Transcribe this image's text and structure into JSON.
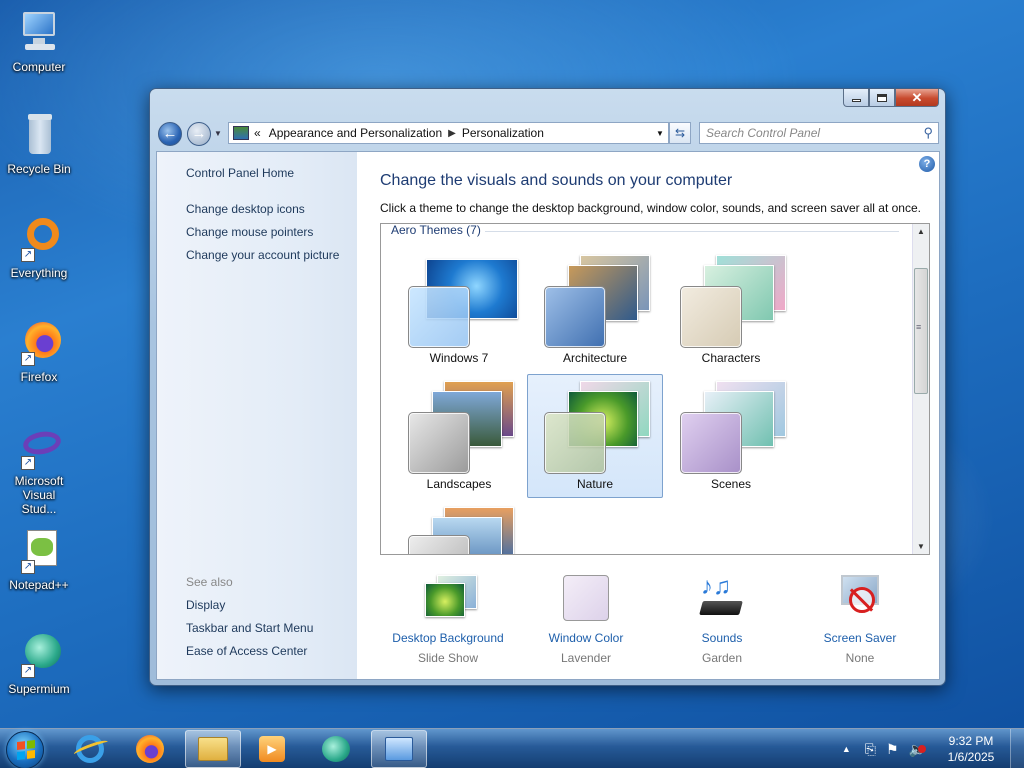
{
  "desktop": {
    "icons": [
      {
        "label": "Computer",
        "icon": "computer-icon"
      },
      {
        "label": "Recycle Bin",
        "icon": "recycle-bin-icon"
      },
      {
        "label": "Everything",
        "icon": "everything-app-icon"
      },
      {
        "label": "Firefox",
        "icon": "firefox-icon"
      },
      {
        "label": "Microsoft Visual Stud...",
        "icon": "visual-studio-icon"
      },
      {
        "label": "Notepad++",
        "icon": "notepad-plus-plus-icon"
      },
      {
        "label": "Supermium",
        "icon": "supermium-icon"
      }
    ]
  },
  "window": {
    "address": {
      "overflow": "«",
      "crumbs": [
        "Appearance and Personalization",
        "Personalization"
      ]
    },
    "search": {
      "placeholder": "Search Control Panel"
    },
    "help": "?",
    "left_pane": {
      "home": "Control Panel Home",
      "links": [
        "Change desktop icons",
        "Change mouse pointers",
        "Change your account picture"
      ],
      "see_also": "See also",
      "see_also_links": [
        "Display",
        "Taskbar and Start Menu",
        "Ease of Access Center"
      ]
    },
    "main": {
      "heading": "Change the visuals and sounds on your computer",
      "subheading": "Click a theme to change the desktop background, window color, sounds, and screen saver all at once.",
      "group_label": "Aero Themes (7)",
      "themes": [
        {
          "name": "Windows 7",
          "selected": false
        },
        {
          "name": "Architecture",
          "selected": false
        },
        {
          "name": "Characters",
          "selected": false
        },
        {
          "name": "Landscapes",
          "selected": false
        },
        {
          "name": "Nature",
          "selected": true
        },
        {
          "name": "Scenes",
          "selected": false
        }
      ]
    },
    "bottom": [
      {
        "label": "Desktop Background",
        "value": "Slide Show",
        "icon": "desktop-background-icon"
      },
      {
        "label": "Window Color",
        "value": "Lavender",
        "icon": "window-color-icon"
      },
      {
        "label": "Sounds",
        "value": "Garden",
        "icon": "sounds-icon"
      },
      {
        "label": "Screen Saver",
        "value": "None",
        "icon": "screen-saver-icon"
      }
    ]
  },
  "taskbar": {
    "clock": {
      "time": "9:32 PM",
      "date": "1/6/2025"
    },
    "tray_expand": "▲"
  }
}
